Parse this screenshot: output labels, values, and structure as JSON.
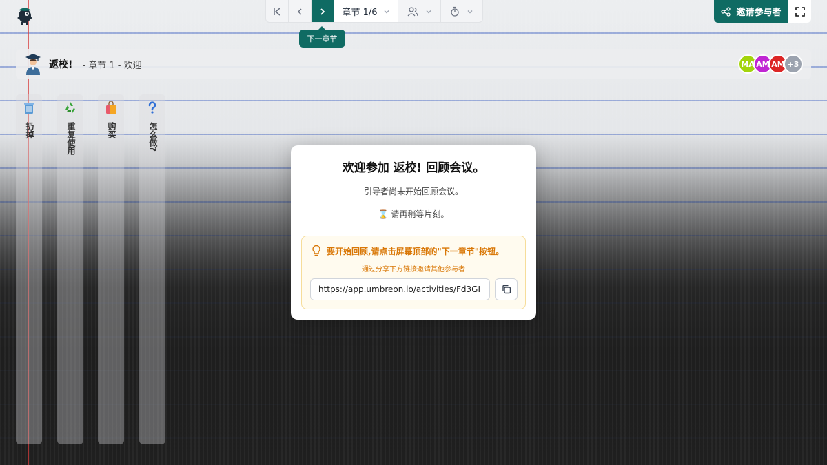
{
  "toolbar": {
    "chapter_label": "章节 1/6",
    "next_tooltip": "下一章节",
    "invite_label": "邀请参与者"
  },
  "header": {
    "title": "返校!",
    "subtitle": "- 章节 1 - 欢迎",
    "avatars": [
      {
        "initials": "MA",
        "color": "#a3d40c"
      },
      {
        "initials": "AM",
        "color": "#c026d3"
      },
      {
        "initials": "AM",
        "color": "#dc2626"
      },
      {
        "initials": "+3",
        "color": "#9ca3af"
      }
    ]
  },
  "columns": [
    {
      "label": "扔掉",
      "icon": "trash-icon"
    },
    {
      "label": "重复使用",
      "icon": "recycle-icon"
    },
    {
      "label": "购买",
      "icon": "shopping-bag-icon"
    },
    {
      "label": "怎么做?",
      "icon": "question-icon"
    }
  ],
  "modal": {
    "title": "欢迎参加 返校! 回顾会议。",
    "subtitle": "引导者尚未开始回顾会议。",
    "wait": "⌛ 请再稍等片刻。",
    "hint_main": "要开始回顾,请点击屏幕顶部的\"下一章节\"按钮。",
    "hint_sub": "通过分享下方链接邀请其他参与者",
    "link": "https://app.umbreon.io/activities/Fd3GI"
  },
  "colors": {
    "accent": "#0f6b63",
    "hint": "#d97706"
  }
}
